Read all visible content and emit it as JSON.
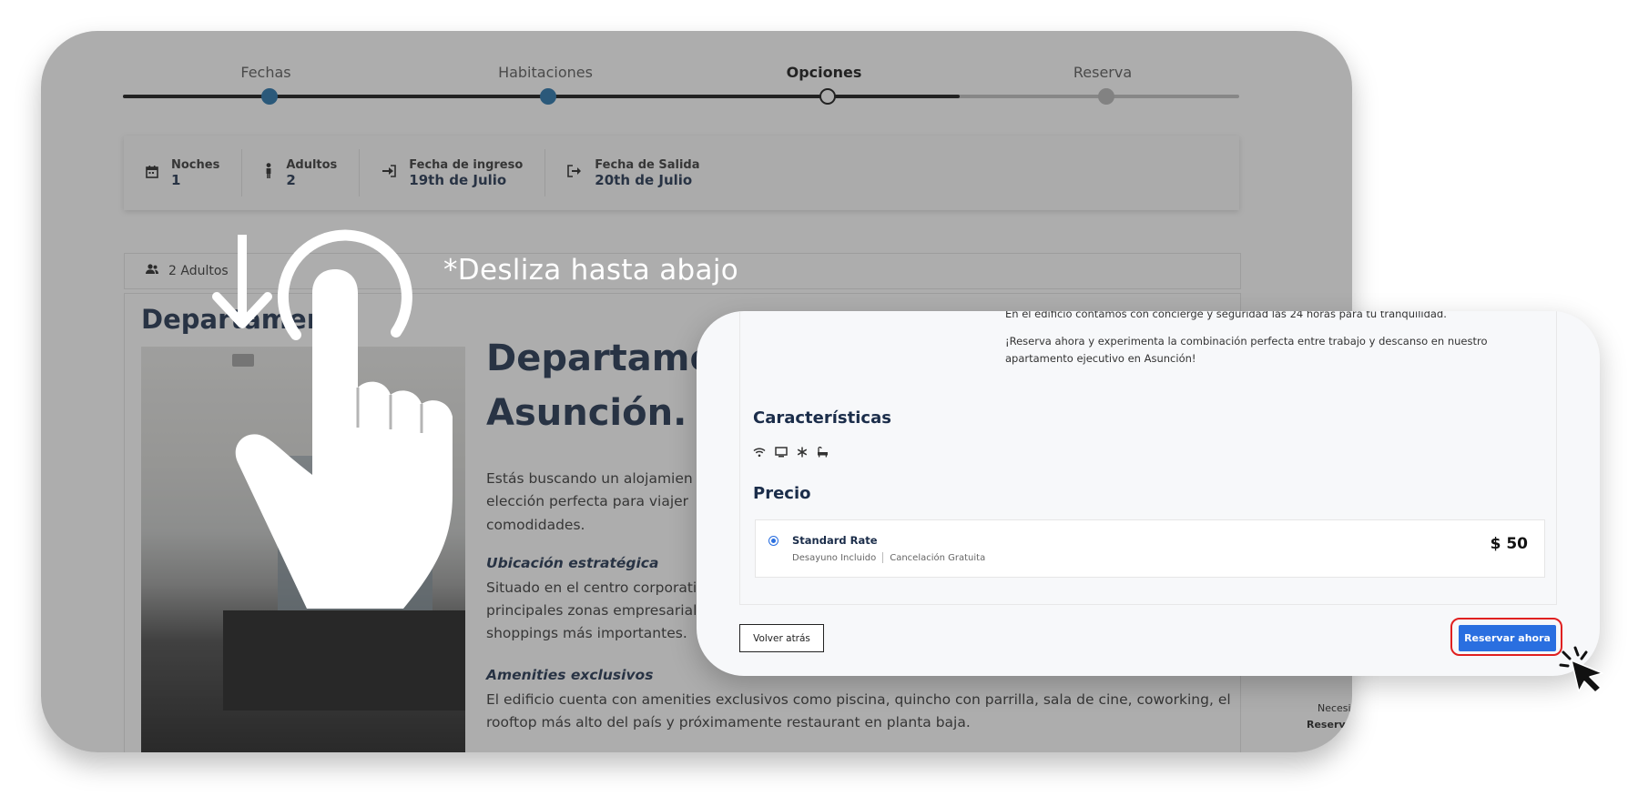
{
  "stepper": {
    "steps": [
      {
        "label": "Fechas",
        "state": "done"
      },
      {
        "label": "Habitaciones",
        "state": "done"
      },
      {
        "label": "Opciones",
        "state": "current"
      },
      {
        "label": "Reserva",
        "state": "todo"
      }
    ]
  },
  "summary": {
    "noches_label": "Noches",
    "noches_value": "1",
    "adultos_label": "Adultos",
    "adultos_value": "2",
    "ingreso_label": "Fecha de ingreso",
    "ingreso_value": "19th de Julio",
    "salida_label": "Fecha de Salida",
    "salida_value": "20th de Julio"
  },
  "guests": {
    "label": "2 Adultos"
  },
  "listing": {
    "card_title": "Departamento",
    "headline": "Departamen Asunción.",
    "intro": [
      "Estás buscando un alojamien",
      "elección perfecta para viajer",
      "comodidades."
    ],
    "location_title": "Ubicación estratégica",
    "location_text": [
      "Situado en el centro corporativ",
      "principales zonas empresariale",
      "shoppings más importantes."
    ],
    "amenities_title": "Amenities exclusivos",
    "amenities_text": [
      "El edificio cuenta con amenities exclusivos como piscina, quincho con parrilla, sala de cine, coworking, el",
      "rooftop más alto del país y próximamente restaurant en planta baja."
    ],
    "side_note_1": "Necesi",
    "side_note_2": "Reservá"
  },
  "overlay": {
    "swipe_text": "*Desliza hasta abajo"
  },
  "popup": {
    "desc_cut": "En el edificio contamos con concierge y seguridad las 24 horas para tu tranquilidad.",
    "desc_main": "¡Reserva ahora y experimenta la combinación perfecta entre trabajo y descanso en nuestro apartamento ejecutivo en Asunción!",
    "features_title": "Características",
    "feature_icons": [
      "wifi-icon",
      "tv-icon",
      "snowflake-icon",
      "bath-icon"
    ],
    "price_title": "Precio",
    "rate_name": "Standard Rate",
    "rate_breakfast": "Desayuno Incluido",
    "rate_cancel": "Cancelación Gratuita",
    "rate_price": "$ 50",
    "back_button": "Volver atrás",
    "book_button": "Reservar ahora"
  },
  "colors": {
    "accent": "#2a6fe0",
    "step_done": "#1f6ea8",
    "highlight": "#e02020",
    "title": "#1b2d4a"
  }
}
